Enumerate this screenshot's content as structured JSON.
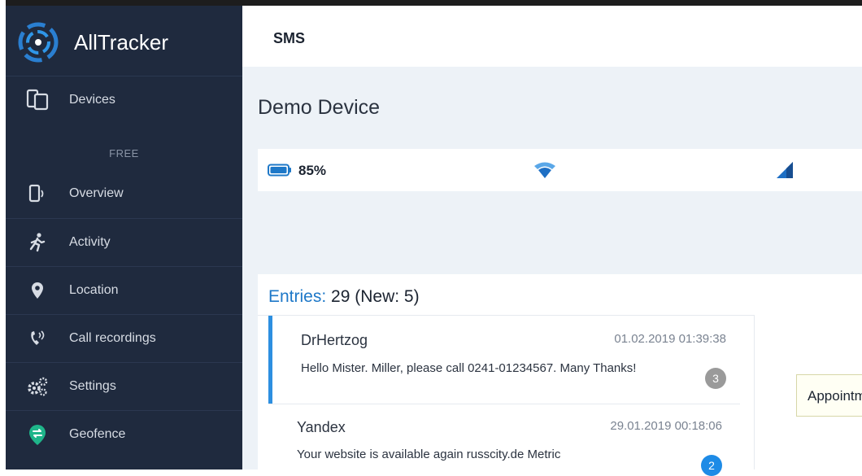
{
  "brand": {
    "name": "AllTracker"
  },
  "sidebar": {
    "devices_label": "Devices",
    "section_label": "FREE",
    "items": [
      {
        "label": "Overview",
        "icon": "phone-signal-icon"
      },
      {
        "label": "Activity",
        "icon": "running-person-icon"
      },
      {
        "label": "Location",
        "icon": "location-pin-icon"
      },
      {
        "label": "Call recordings",
        "icon": "phone-call-icon"
      },
      {
        "label": "Settings",
        "icon": "gears-icon"
      },
      {
        "label": "Geofence",
        "icon": "geofence-icon"
      }
    ]
  },
  "header": {
    "title": "SMS"
  },
  "device": {
    "name": "Demo Device",
    "battery": "85%",
    "battery_level": 0.85
  },
  "entries": {
    "label": "Entries:",
    "summary": "29 (New: 5)"
  },
  "messages": [
    {
      "sender": "DrHertzog",
      "time": "01.02.2019 01:39:38",
      "text": "Hello Mister. Miller, please call 0241-01234567. Many Thanks!",
      "count": "3"
    },
    {
      "sender": "Yandex",
      "time": "29.01.2019 00:18:06",
      "text": "Your website is available again russcity.de Metric",
      "count": "2"
    }
  ],
  "preview": {
    "text": "Appointm"
  },
  "colors": {
    "sidebar_bg": "#1f2a3e",
    "accent": "#1e78c8",
    "active_border": "#2d8fe0",
    "badge_gray": "#9a9a9a",
    "badge_blue": "#1e8be6"
  }
}
